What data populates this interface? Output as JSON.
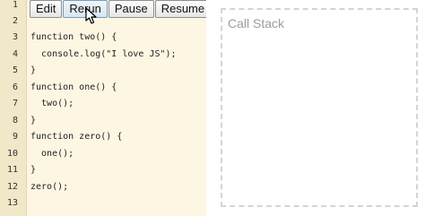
{
  "toolbar": {
    "edit": "Edit",
    "rerun": "Rerun",
    "pause": "Pause",
    "resume": "Resume"
  },
  "editor": {
    "line_numbers": [
      "1",
      "2",
      "3",
      "4",
      "5",
      "6",
      "7",
      "8",
      "9",
      "10",
      "11",
      "12",
      "13"
    ],
    "lines": [
      "",
      "",
      "function two() {",
      "  console.log(\"I love JS\");",
      "}",
      "function one() {",
      "  two();",
      "}",
      "function zero() {",
      "  one();",
      "}",
      "zero();",
      ""
    ]
  },
  "call_stack": {
    "title": "Call Stack"
  },
  "icons": {
    "pointer": "mouse-pointer-icon"
  }
}
